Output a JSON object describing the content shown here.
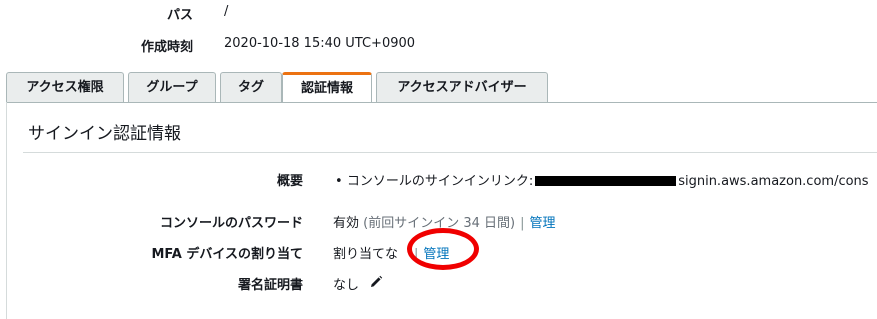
{
  "summary": {
    "path_label": "パス",
    "path_value": "/",
    "created_label": "作成時刻",
    "created_value": "2020-10-18 15:40 UTC+0900"
  },
  "tabs": [
    {
      "label": "アクセス権限",
      "active": false
    },
    {
      "label": "グループ",
      "active": false
    },
    {
      "label": "タグ",
      "active": false
    },
    {
      "label": "認証情報",
      "active": true
    },
    {
      "label": "アクセスアドバイザー",
      "active": false
    }
  ],
  "section": {
    "title": "サインイン認証情報",
    "overview_label": "概要",
    "overview_bullet": "•",
    "overview_text_prefix": "コンソールのサインインリンク:",
    "overview_text_suffix": "signin.aws.amazon.com/cons",
    "console_password_label": "コンソールのパスワード",
    "console_password_status": "有効",
    "console_password_detail": "(前回サインイン 34 日間)",
    "separator": "|",
    "manage_label": "管理",
    "mfa_label": "MFA デバイスの割り当て",
    "mfa_value": "割り当てな",
    "mfa_manage_label": "管理",
    "signing_cert_label": "署名証明書",
    "signing_cert_value": "なし"
  },
  "colors": {
    "accent": "#ec7211",
    "link": "#0073bb",
    "annotation": "#f00000"
  },
  "icons": {
    "edit": "pencil-icon"
  }
}
